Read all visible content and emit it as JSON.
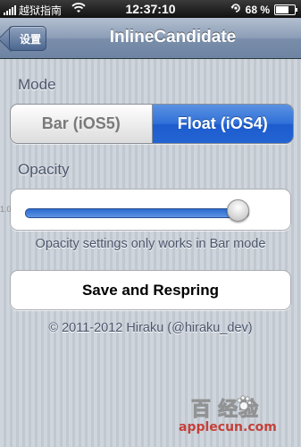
{
  "status_bar": {
    "carrier": "越狱指南",
    "time": "12:37:10",
    "battery": "68 %",
    "battery_level": 0.68
  },
  "nav": {
    "back_label": "设置",
    "title": "InlineCandidate"
  },
  "mode": {
    "label": "Mode",
    "options": [
      "Bar (iOS5)",
      "Float (iOS4)"
    ],
    "selected": "Float (iOS4)"
  },
  "opacity": {
    "label": "Opacity",
    "min_label": "1.0",
    "value": 1.0,
    "note": "Opacity settings only works in Bar mode"
  },
  "actions": {
    "save_label": "Save and Respring"
  },
  "footer": {
    "copyright": "© 2011-2012 Hiraku (@hiraku_dev)"
  },
  "watermark": {
    "text_line1": "百 经验",
    "text_line2": "applecun.com"
  }
}
